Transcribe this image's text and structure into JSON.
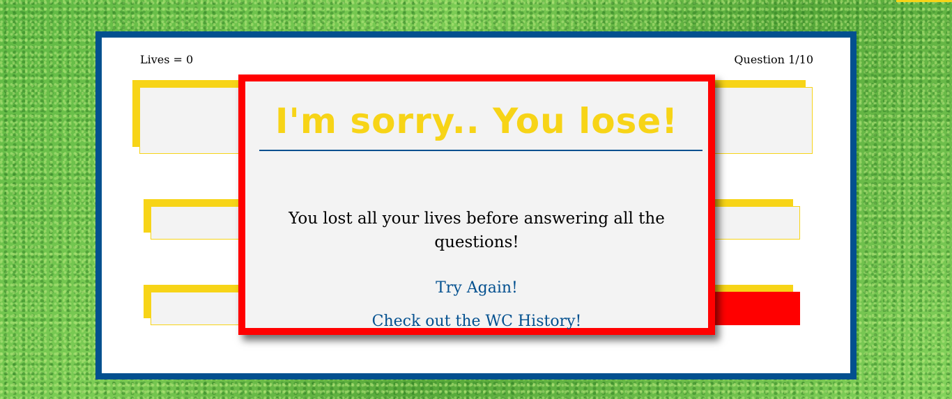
{
  "game": {
    "lives_label": "Lives = 0",
    "question_label": "Question 1/10"
  },
  "modal": {
    "title": "I'm sorry.. You lose!",
    "message": "You lost all your lives before answering all the questions!",
    "try_again_label": "Try Again!",
    "history_label": "Check out the WC History!"
  },
  "colors": {
    "primary_blue": "#03508f",
    "accent_yellow": "#f7d417",
    "alert_red": "#ff0000",
    "panel_gray": "#f3f3f3",
    "grass_green": "#6cc04a"
  }
}
